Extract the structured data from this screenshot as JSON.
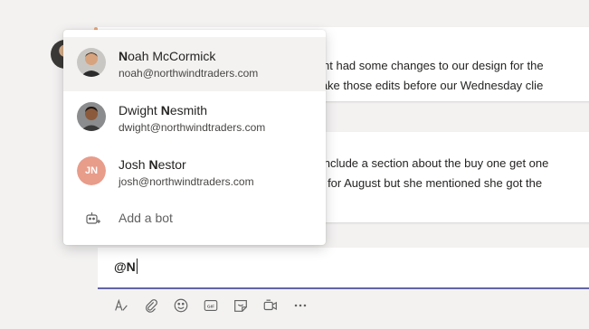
{
  "messages": [
    {
      "line1": "lient had some changes to our design for the",
      "line2": "make those edits before our Wednesday clie"
    },
    {
      "line1": "o include a section about the buy one get one",
      "line2": "ed for August but she mentioned she got the"
    }
  ],
  "mention_suggestions": [
    {
      "name_bold": "N",
      "name_rest": "oah McCormick",
      "name_prefix": "",
      "email": "noah@northwindtraders.com",
      "avatar": "photo"
    },
    {
      "name_prefix": "Dwight ",
      "name_bold": "N",
      "name_rest": "esmith",
      "email": "dwight@northwindtraders.com",
      "avatar": "photo"
    },
    {
      "name_prefix": "Josh ",
      "name_bold": "N",
      "name_rest": "estor",
      "email": "josh@northwindtraders.com",
      "initials": "JN"
    }
  ],
  "add_bot": {
    "label": "Add a bot",
    "icon": "bot-add-icon"
  },
  "compose": {
    "value": "@N"
  },
  "toolbar": [
    "format-icon",
    "attach-icon",
    "emoji-icon",
    "gif-icon",
    "sticker-icon",
    "meet-now-icon",
    "more-options-icon"
  ],
  "colors": {
    "accent": "#6264a7",
    "initials_bg": "#e89c8a"
  }
}
